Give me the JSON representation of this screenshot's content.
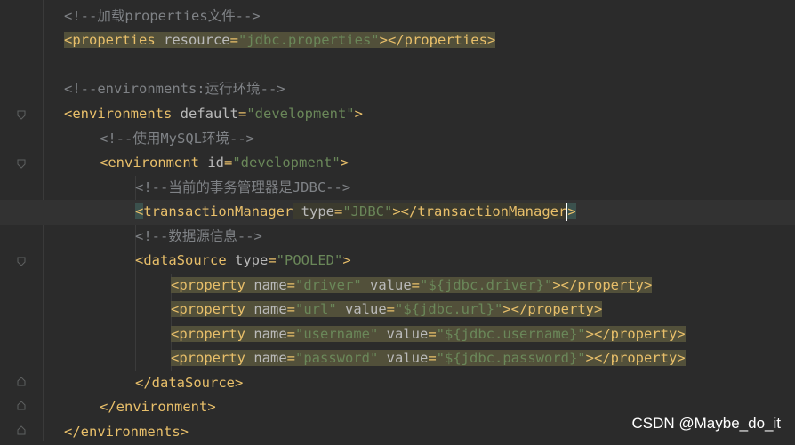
{
  "code_lines": [
    {
      "id": "l1",
      "segments": [
        {
          "cls": "comment",
          "text": "<!--加载properties文件-->"
        }
      ]
    },
    {
      "id": "l2",
      "segments": [
        {
          "cls": "tag hl",
          "text": "<properties "
        },
        {
          "cls": "attr hl",
          "text": "resource"
        },
        {
          "cls": "tag hl",
          "text": "="
        },
        {
          "cls": "val hl",
          "text": "\"jdbc.properties\""
        },
        {
          "cls": "tag hl",
          "text": "></properties>"
        }
      ]
    },
    {
      "id": "l3",
      "segments": []
    },
    {
      "id": "l4",
      "segments": [
        {
          "cls": "comment",
          "text": "<!--environments:运行环境-->"
        }
      ]
    },
    {
      "id": "l5",
      "segments": [
        {
          "cls": "tag",
          "text": "<environments "
        },
        {
          "cls": "attr",
          "text": "default"
        },
        {
          "cls": "tag",
          "text": "="
        },
        {
          "cls": "val",
          "text": "\"development\""
        },
        {
          "cls": "tag",
          "text": ">"
        }
      ]
    },
    {
      "id": "l6",
      "segments": [
        {
          "cls": "comment",
          "text": "<!--使用MySQL环境-->"
        }
      ]
    },
    {
      "id": "l7",
      "segments": [
        {
          "cls": "tag",
          "text": "<environment "
        },
        {
          "cls": "attr",
          "text": "id"
        },
        {
          "cls": "tag",
          "text": "="
        },
        {
          "cls": "val",
          "text": "\"development\""
        },
        {
          "cls": "tag",
          "text": ">"
        }
      ]
    },
    {
      "id": "l8",
      "segments": [
        {
          "cls": "comment",
          "text": "<!--当前的事务管理器是JDBC-->"
        }
      ]
    },
    {
      "id": "l9",
      "segments": [
        {
          "cls": "tag bracematch",
          "text": "<"
        },
        {
          "cls": "tag",
          "text": "transactionManager"
        },
        {
          "cls": "attr hl2",
          "text": " type"
        },
        {
          "cls": "tag hl2",
          "text": "="
        },
        {
          "cls": "val hl2",
          "text": "\"JDBC\""
        },
        {
          "cls": "tag hl2",
          "text": "></"
        },
        {
          "cls": "tag hl2",
          "text": "transactionManager"
        },
        {
          "cls": "tag bracematch",
          "text": ">"
        }
      ]
    },
    {
      "id": "l10",
      "segments": [
        {
          "cls": "comment",
          "text": "<!--数据源信息-->"
        }
      ]
    },
    {
      "id": "l11",
      "segments": [
        {
          "cls": "tag",
          "text": "<dataSource "
        },
        {
          "cls": "attr",
          "text": "type"
        },
        {
          "cls": "tag",
          "text": "="
        },
        {
          "cls": "val",
          "text": "\"POOLED\""
        },
        {
          "cls": "tag",
          "text": ">"
        }
      ]
    },
    {
      "id": "l12",
      "segments": [
        {
          "cls": "tag hl",
          "text": "<property "
        },
        {
          "cls": "attr hl",
          "text": "name"
        },
        {
          "cls": "tag hl",
          "text": "="
        },
        {
          "cls": "val hl",
          "text": "\"driver\" "
        },
        {
          "cls": "attr hl",
          "text": "value"
        },
        {
          "cls": "tag hl",
          "text": "="
        },
        {
          "cls": "val hl",
          "text": "\"${jdbc.driver}\""
        },
        {
          "cls": "tag hl",
          "text": "></property>"
        }
      ]
    },
    {
      "id": "l13",
      "segments": [
        {
          "cls": "tag hl",
          "text": "<property "
        },
        {
          "cls": "attr hl",
          "text": "name"
        },
        {
          "cls": "tag hl",
          "text": "="
        },
        {
          "cls": "val hl",
          "text": "\"url\" "
        },
        {
          "cls": "attr hl",
          "text": "value"
        },
        {
          "cls": "tag hl",
          "text": "="
        },
        {
          "cls": "val hl",
          "text": "\"${jdbc.url}\""
        },
        {
          "cls": "tag hl",
          "text": "></property>"
        }
      ]
    },
    {
      "id": "l14",
      "segments": [
        {
          "cls": "tag hl",
          "text": "<property "
        },
        {
          "cls": "attr hl",
          "text": "name"
        },
        {
          "cls": "tag hl",
          "text": "="
        },
        {
          "cls": "val hl",
          "text": "\"username\" "
        },
        {
          "cls": "attr hl",
          "text": "value"
        },
        {
          "cls": "tag hl",
          "text": "="
        },
        {
          "cls": "val hl",
          "text": "\"${jdbc.username}\""
        },
        {
          "cls": "tag hl",
          "text": "></property>"
        }
      ]
    },
    {
      "id": "l15",
      "segments": [
        {
          "cls": "tag hl",
          "text": "<property "
        },
        {
          "cls": "attr hl",
          "text": "name"
        },
        {
          "cls": "tag hl",
          "text": "="
        },
        {
          "cls": "val hl",
          "text": "\"password\" "
        },
        {
          "cls": "attr hl",
          "text": "value"
        },
        {
          "cls": "tag hl",
          "text": "="
        },
        {
          "cls": "val hl",
          "text": "\"${jdbc.password}\""
        },
        {
          "cls": "tag hl",
          "text": "></property>"
        }
      ]
    },
    {
      "id": "l16",
      "segments": [
        {
          "cls": "tag",
          "text": "</dataSource>"
        }
      ]
    },
    {
      "id": "l17",
      "segments": [
        {
          "cls": "tag",
          "text": "</environment>"
        }
      ]
    },
    {
      "id": "l18",
      "segments": [
        {
          "cls": "tag",
          "text": "</environments>"
        }
      ]
    }
  ],
  "watermark": "CSDN @Maybe_do_it",
  "colors": {
    "background": "#2b2b2b",
    "tag": "#e8bf6a",
    "attribute": "#bababa",
    "string": "#6a8759",
    "comment": "#7f8286",
    "highlight": "#52503a"
  }
}
